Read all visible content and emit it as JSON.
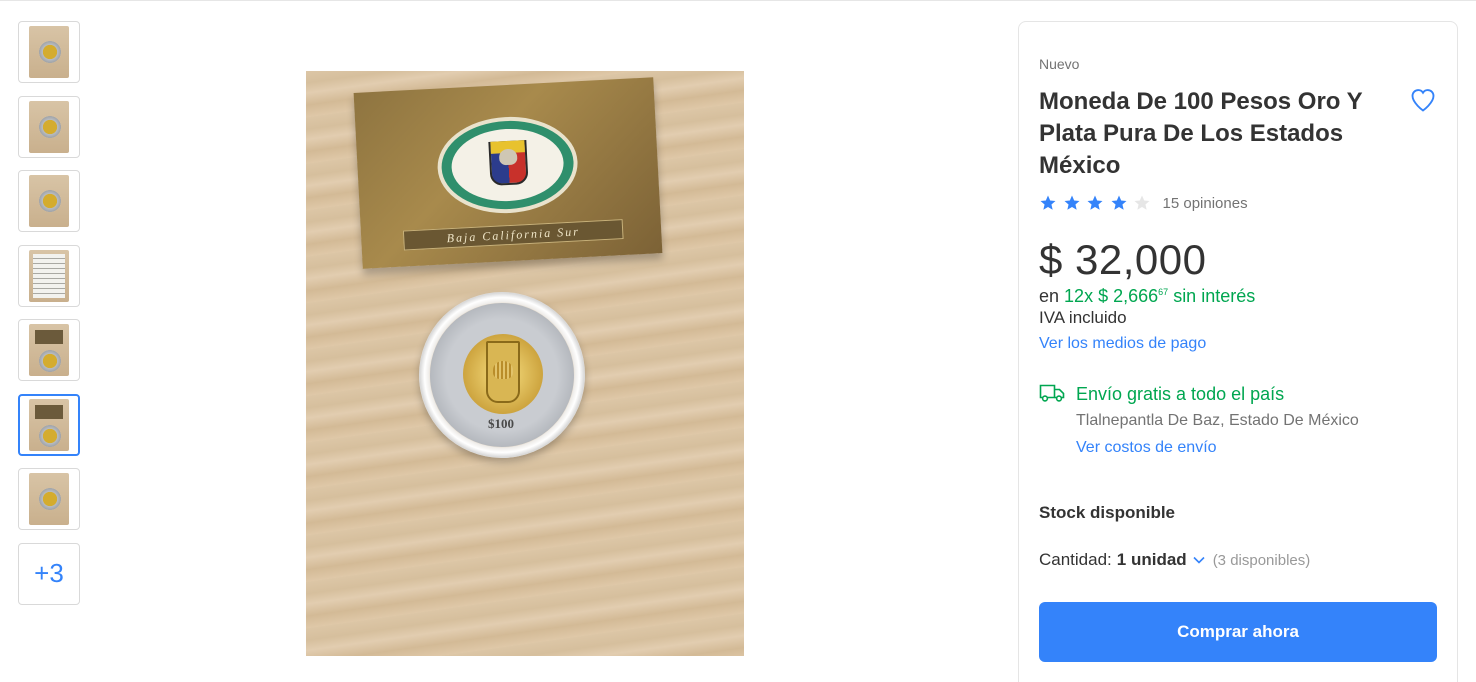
{
  "gallery": {
    "thumbnails": [
      {
        "kind": "coin",
        "selected": false
      },
      {
        "kind": "coin",
        "selected": false
      },
      {
        "kind": "coin",
        "selected": false
      },
      {
        "kind": "document",
        "selected": false
      },
      {
        "kind": "book-coin",
        "selected": false
      },
      {
        "kind": "book-coin",
        "selected": true
      },
      {
        "kind": "coin",
        "selected": false
      }
    ],
    "more_label": "+3",
    "main_image": {
      "folder_caption": "Baja California Sur",
      "coin_value_text": "$100"
    }
  },
  "product": {
    "condition": "Nuevo",
    "title": "Moneda De 100 Pesos Oro Y Plata Pura De Los Estados México",
    "rating_stars": 4,
    "rating_max": 5,
    "reviews_label": "15 opiniones",
    "price": "$ 32,000",
    "installments": {
      "prefix": "en",
      "count": "12x",
      "amount": "$ 2,666",
      "cents": "67",
      "suffix": "sin interés"
    },
    "tax_note": "IVA incluido",
    "payment_link": "Ver los medios de pago"
  },
  "shipping": {
    "title": "Envío gratis a todo el país",
    "location": "Tlalnepantla De Baz, Estado De México",
    "costs_link": "Ver costos de envío"
  },
  "stock": {
    "label": "Stock disponible",
    "quantity_label": "Cantidad:",
    "quantity_value": "1 unidad",
    "available": "(3 disponibles)"
  },
  "buy_button": "Comprar ahora",
  "colors": {
    "accent": "#3483fa",
    "green": "#00a650",
    "star": "#3483fa",
    "star_empty": "#e6e6e6"
  }
}
